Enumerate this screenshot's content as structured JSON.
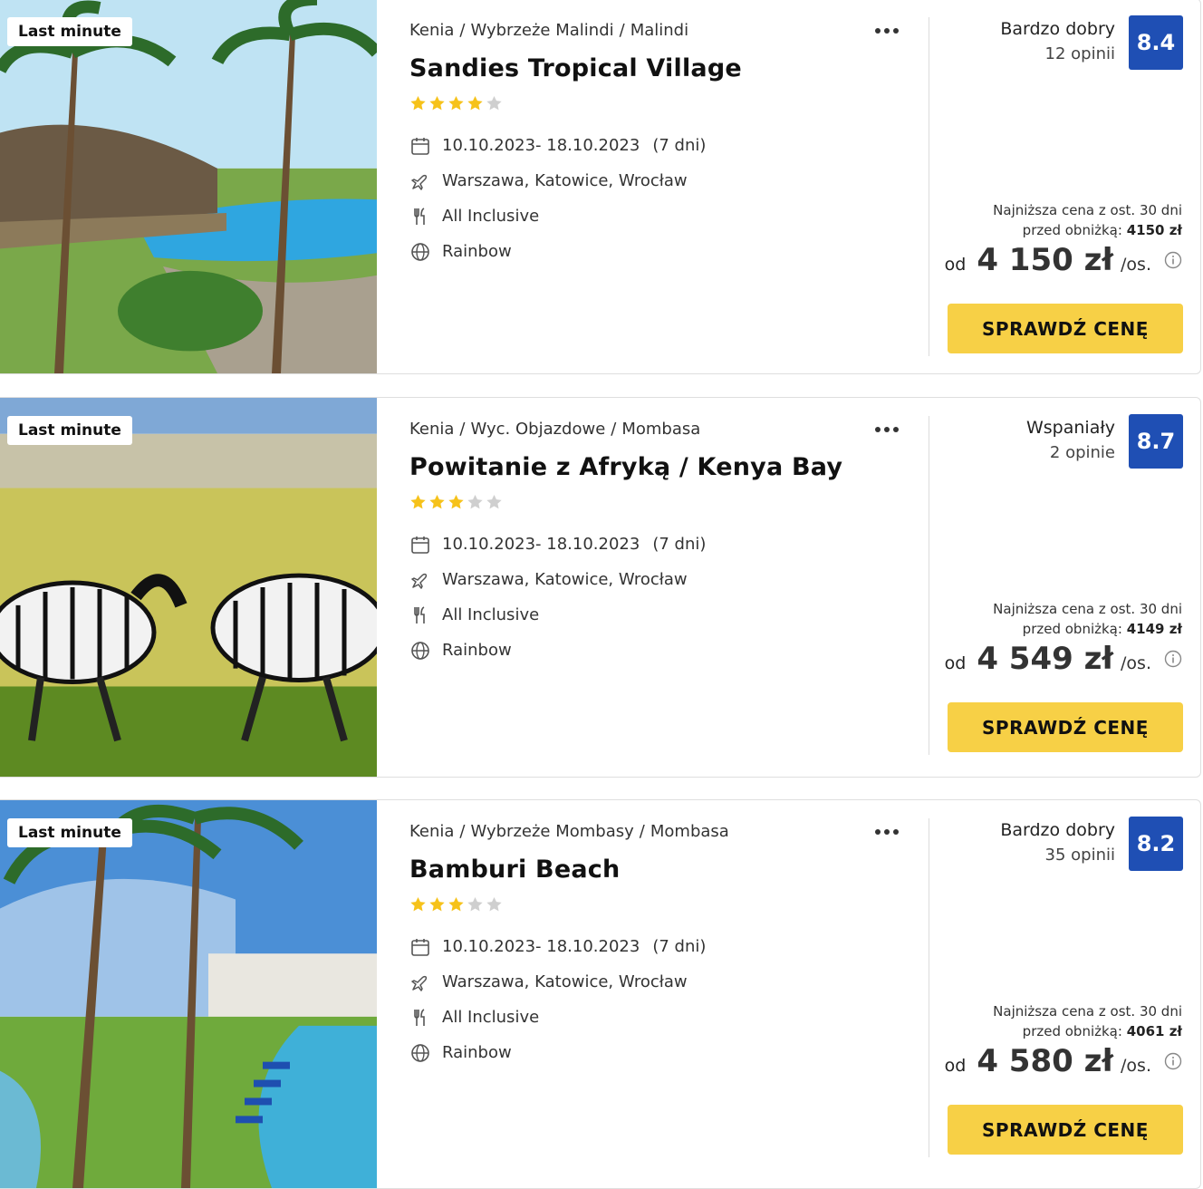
{
  "badge_label": "Last minute",
  "more_icon": "more-dots-icon",
  "cta_label": "SPRAWDŹ CENĘ",
  "colors": {
    "score_bg": "#1f4fb4",
    "cta_bg": "#f7d046",
    "star_on": "#f6c21a",
    "star_off": "#cfcfcf"
  },
  "offers": [
    {
      "location": [
        "Kenia",
        "Wybrzeże Malindi",
        "Malindi"
      ],
      "name": "Sandies Tropical Village",
      "stars": 4,
      "dates": "10.10.2023- 18.10.2023",
      "duration": "(7 dni)",
      "departures": "Warszawa, Katowice, Wrocław",
      "board": "All Inclusive",
      "operator": "Rainbow",
      "rating_word": "Bardzo dobry",
      "rating_count": "12 opinii",
      "score": "8.4",
      "lowest_label_1": "Najniższa cena z ost. 30 dni",
      "lowest_label_2": "przed obniżką:",
      "lowest_value": "4150 zł",
      "price_prefix": "od",
      "price": "4 150 zł",
      "price_suffix": "/os."
    },
    {
      "location": [
        "Kenia",
        "Wyc. Objazdowe",
        "Mombasa"
      ],
      "name": "Powitanie z Afryką / Kenya Bay",
      "stars": 3,
      "dates": "10.10.2023- 18.10.2023",
      "duration": "(7 dni)",
      "departures": "Warszawa, Katowice, Wrocław",
      "board": "All Inclusive",
      "operator": "Rainbow",
      "rating_word": "Wspaniały",
      "rating_count": "2 opinie",
      "score": "8.7",
      "lowest_label_1": "Najniższa cena z ost. 30 dni",
      "lowest_label_2": "przed obniżką:",
      "lowest_value": "4149 zł",
      "price_prefix": "od",
      "price": "4 549 zł",
      "price_suffix": "/os."
    },
    {
      "location": [
        "Kenia",
        "Wybrzeże Mombasy",
        "Mombasa"
      ],
      "name": "Bamburi Beach",
      "stars": 3,
      "dates": "10.10.2023- 18.10.2023",
      "duration": "(7 dni)",
      "departures": "Warszawa, Katowice, Wrocław",
      "board": "All Inclusive",
      "operator": "Rainbow",
      "rating_word": "Bardzo dobry",
      "rating_count": "35 opinii",
      "score": "8.2",
      "lowest_label_1": "Najniższa cena z ost. 30 dni",
      "lowest_label_2": "przed obniżką:",
      "lowest_value": "4061 zł",
      "price_prefix": "od",
      "price": "4 580 zł",
      "price_suffix": "/os."
    }
  ]
}
